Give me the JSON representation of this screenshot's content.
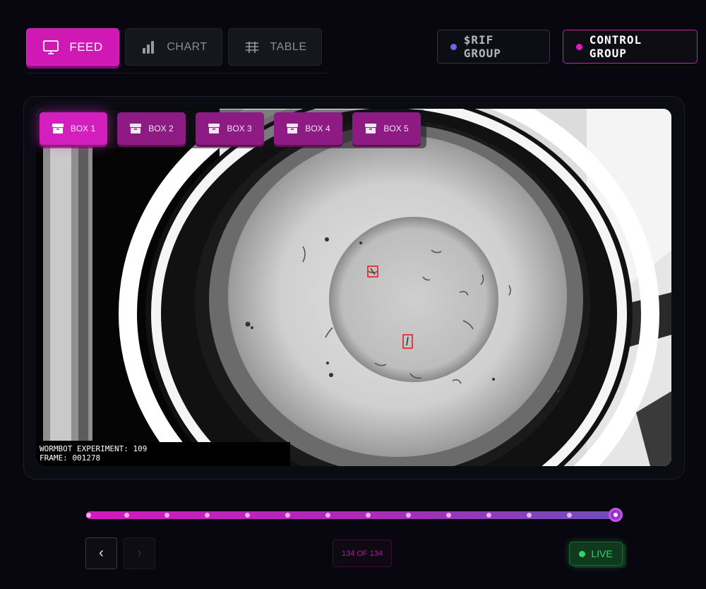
{
  "view_tabs": [
    {
      "label": "FEED",
      "icon": "monitor-icon",
      "active": true
    },
    {
      "label": "CHART",
      "icon": "bar-chart-icon",
      "active": false
    },
    {
      "label": "TABLE",
      "icon": "table-icon",
      "active": false
    }
  ],
  "groups": {
    "rif": {
      "label": "$RIF GROUP",
      "color": "#6f64e8"
    },
    "control": {
      "label": "CONTROL GROUP",
      "color": "#e11ac2",
      "active": true
    }
  },
  "box_tabs": [
    {
      "label": "BOX 1",
      "active": true
    },
    {
      "label": "BOX 2",
      "active": false
    },
    {
      "label": "BOX 3",
      "active": false
    },
    {
      "label": "BOX 4",
      "active": false
    },
    {
      "label": "BOX 5",
      "active": false
    }
  ],
  "feed": {
    "overlay_line1": "WORMBOT EXPERIMENT: 109",
    "overlay_line2": "FRAME: 001278"
  },
  "timeline": {
    "current": 134,
    "total": 134,
    "counter_text": "134 OF 134"
  },
  "navigation": {
    "prev_label": "‹",
    "next_label": "›"
  },
  "status": {
    "live_label": "LIVE",
    "live_color": "#33d36a"
  },
  "colors": {
    "accent": "#cf18b4",
    "background": "#08070f"
  }
}
